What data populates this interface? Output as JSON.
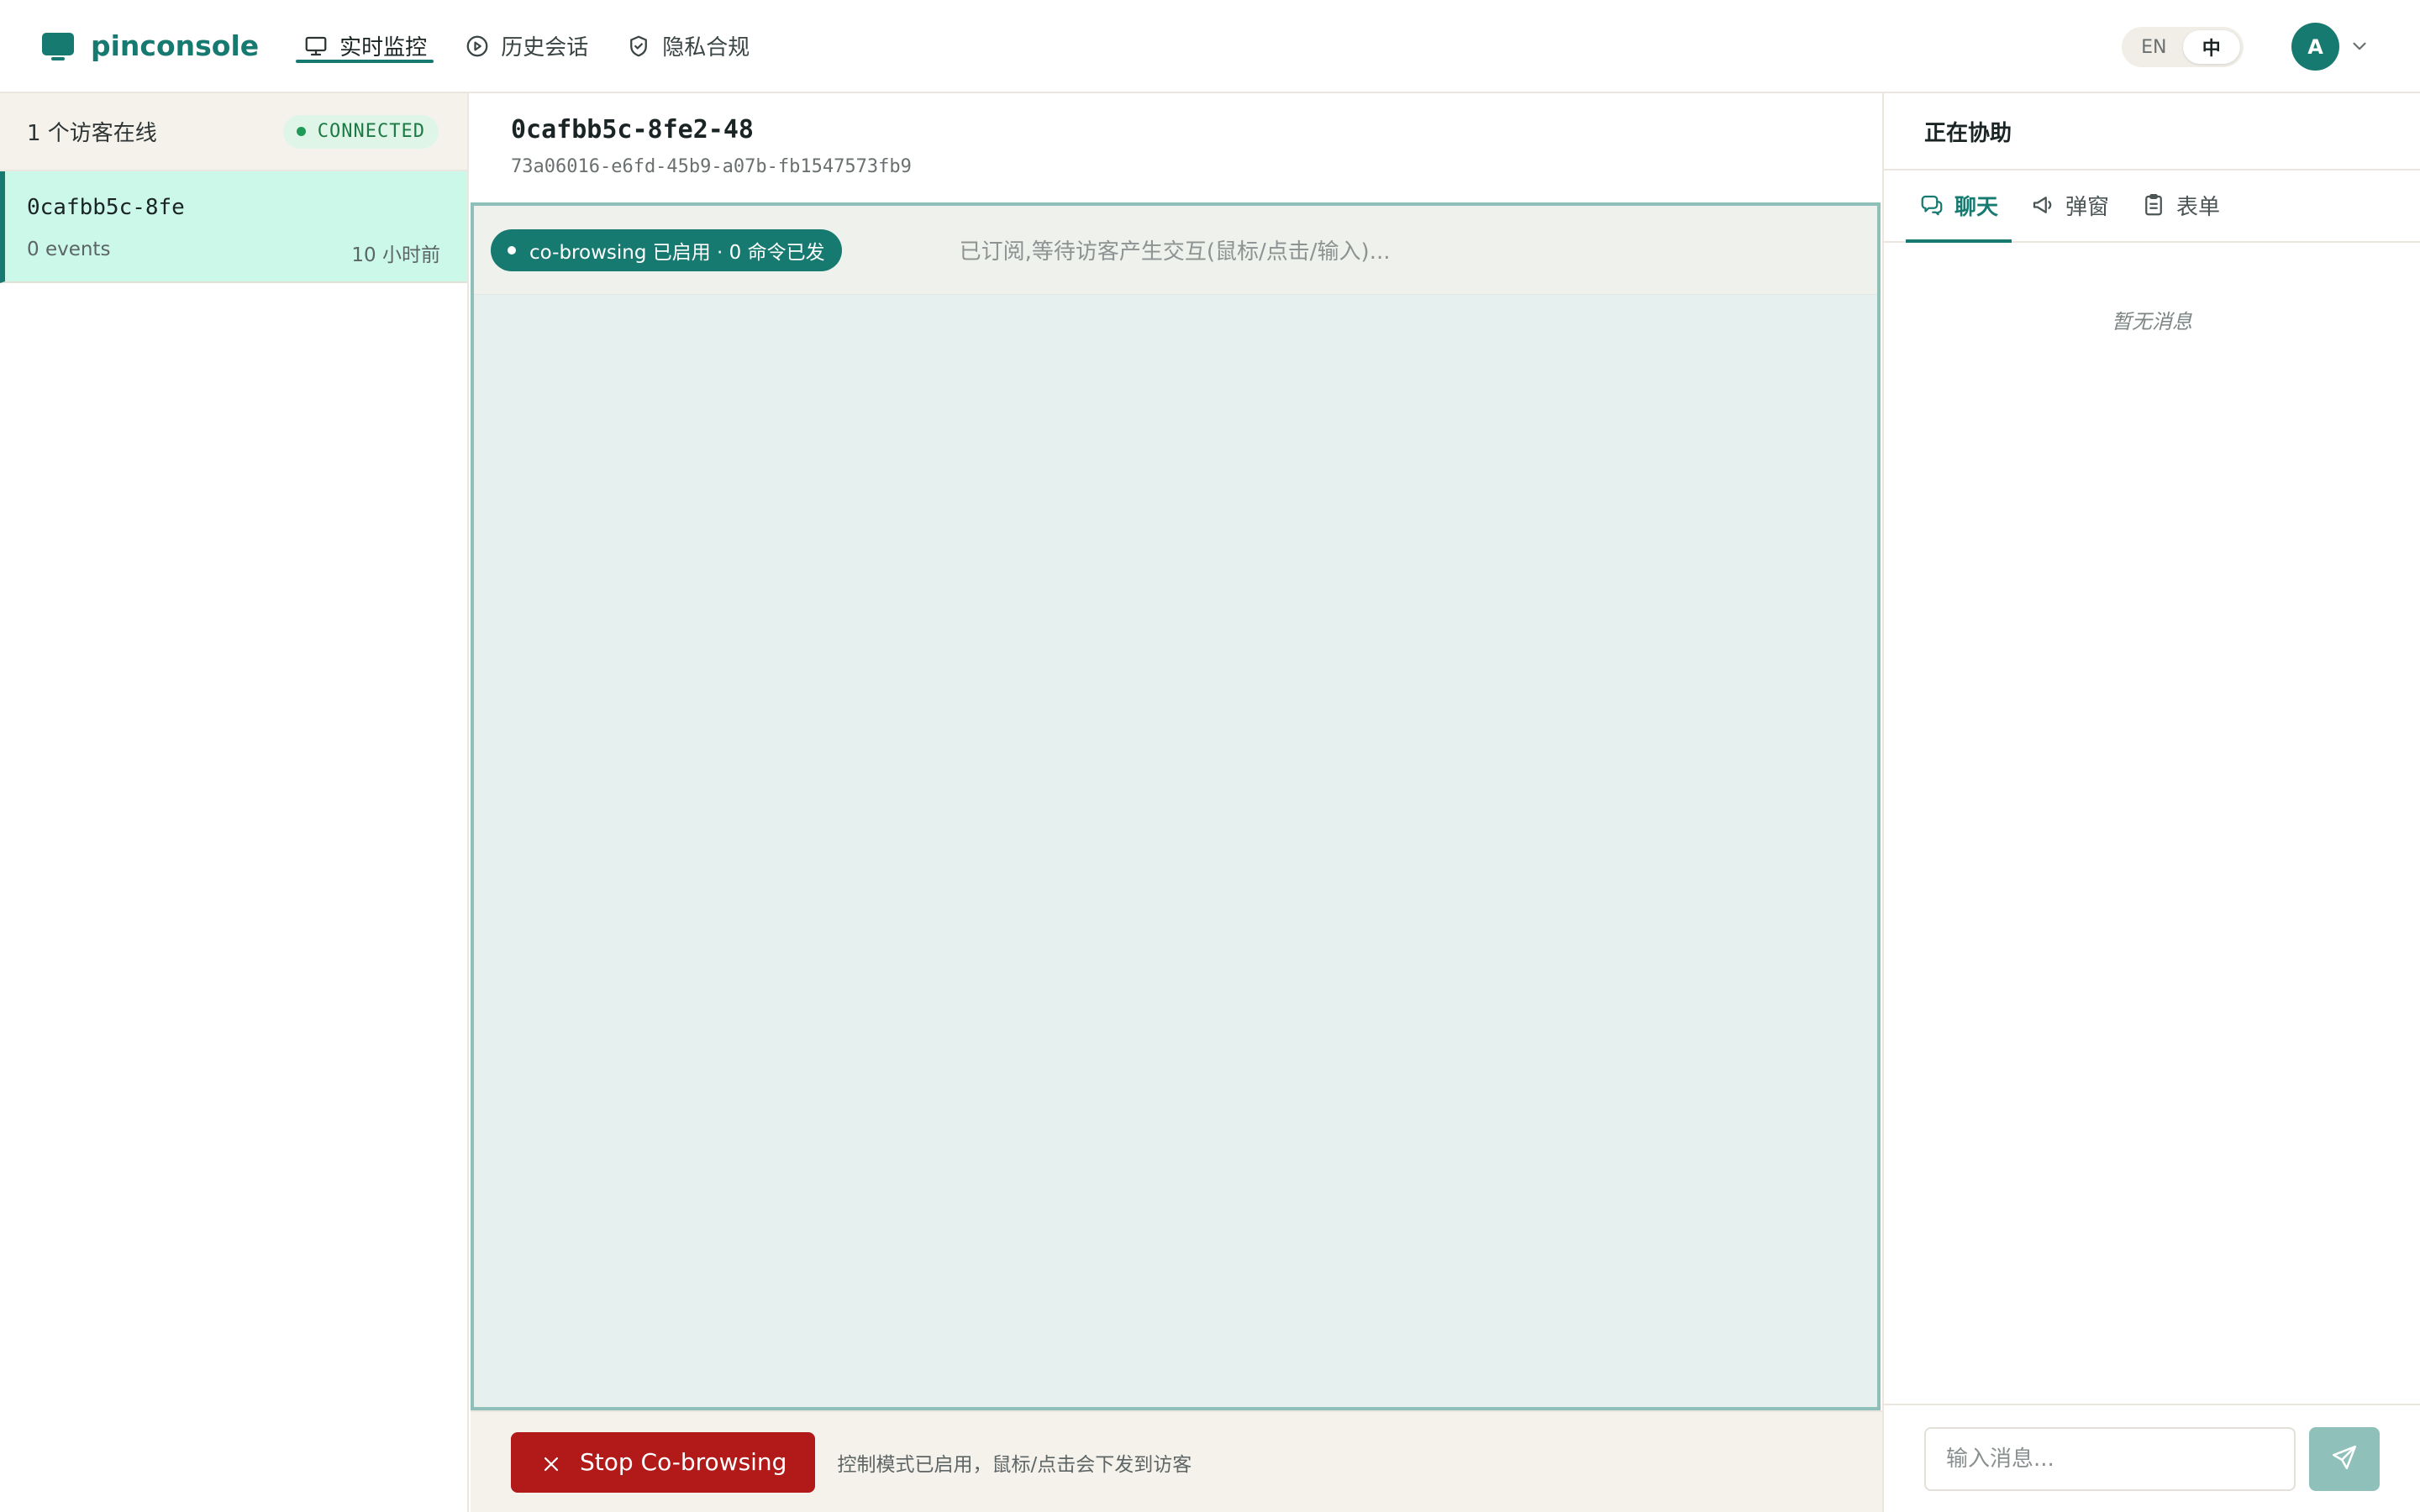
{
  "brand": {
    "name": "pinconsole",
    "icon": "monitor-icon",
    "color": "#177a70"
  },
  "nav": [
    {
      "label": "实时监控",
      "icon": "monitor-icon",
      "active": true
    },
    {
      "label": "历史会话",
      "icon": "play-circle-icon",
      "active": false
    },
    {
      "label": "隐私合规",
      "icon": "shield-check-icon",
      "active": false
    }
  ],
  "lang": {
    "en": "EN",
    "zh": "中",
    "active": "zh"
  },
  "user": {
    "initial": "A"
  },
  "visitors": {
    "count_label": "1 个访客在线",
    "status": "CONNECTED",
    "items": [
      {
        "id": "0cafbb5c-8fe",
        "events": "0 events",
        "time": "10 小时前"
      }
    ]
  },
  "session": {
    "title": "0cafbb5c-8fe2-48",
    "uuid": "73a06016-e6fd-45b9-a07b-fb1547573fb9",
    "cobrowse_pill": "co-browsing 已启用 · 0 命令已发",
    "status_text": "已订阅,等待访客产生交互(鼠标/点击/输入)..."
  },
  "controls": {
    "stop_label": "Stop Co-browsing",
    "hint": "控制模式已启用，鼠标/点击会下发到访客"
  },
  "assist": {
    "title": "正在协助",
    "tabs": [
      {
        "label": "聊天",
        "icon": "chat-bubbles-icon",
        "active": true
      },
      {
        "label": "弹窗",
        "icon": "megaphone-icon",
        "active": false
      },
      {
        "label": "表单",
        "icon": "clipboard-icon",
        "active": false
      }
    ],
    "empty": "暂无消息",
    "input_placeholder": "输入消息...",
    "send_icon": "send-icon"
  },
  "colors": {
    "accent": "#177a70",
    "danger": "#b21a1a",
    "connected": "#1f9a57",
    "selected_row": "#ccf8e9"
  }
}
